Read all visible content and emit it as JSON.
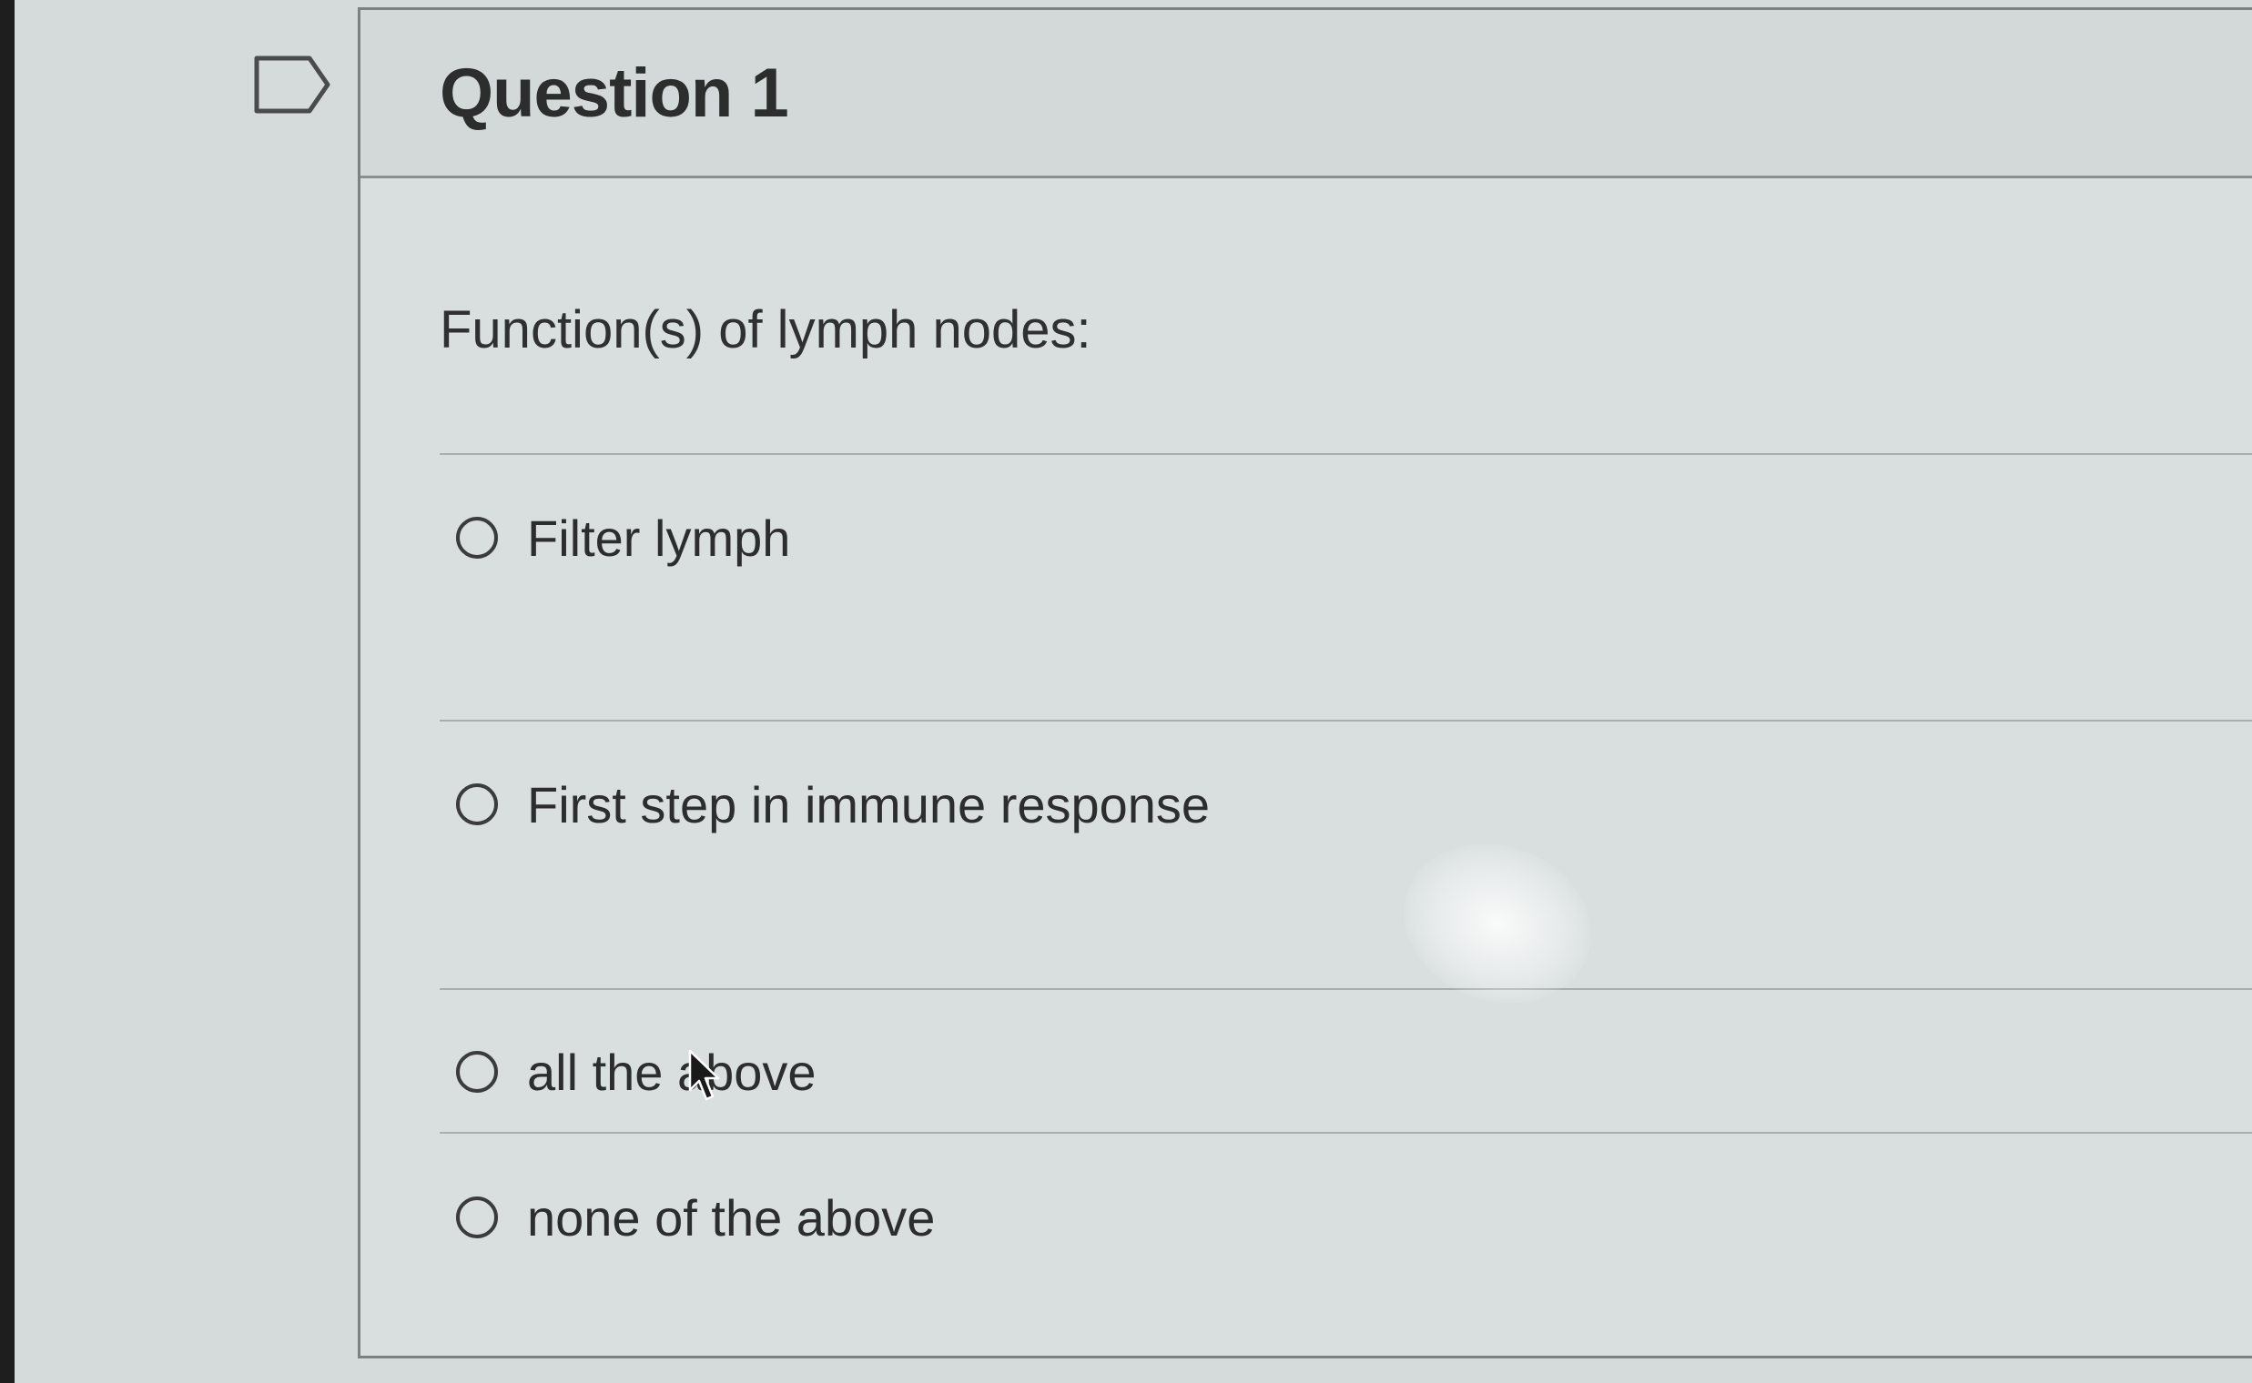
{
  "question": {
    "title": "Question 1",
    "prompt": "Function(s) of lymph nodes:"
  },
  "options": [
    {
      "label": "Filter lymph",
      "selected": false
    },
    {
      "label": "First step in immune response",
      "selected": false
    },
    {
      "label": "all the above",
      "selected": false
    },
    {
      "label": "none of the above",
      "selected": false
    }
  ],
  "icons": {
    "flag": "flag-icon",
    "cursor": "mouse-pointer-icon"
  }
}
